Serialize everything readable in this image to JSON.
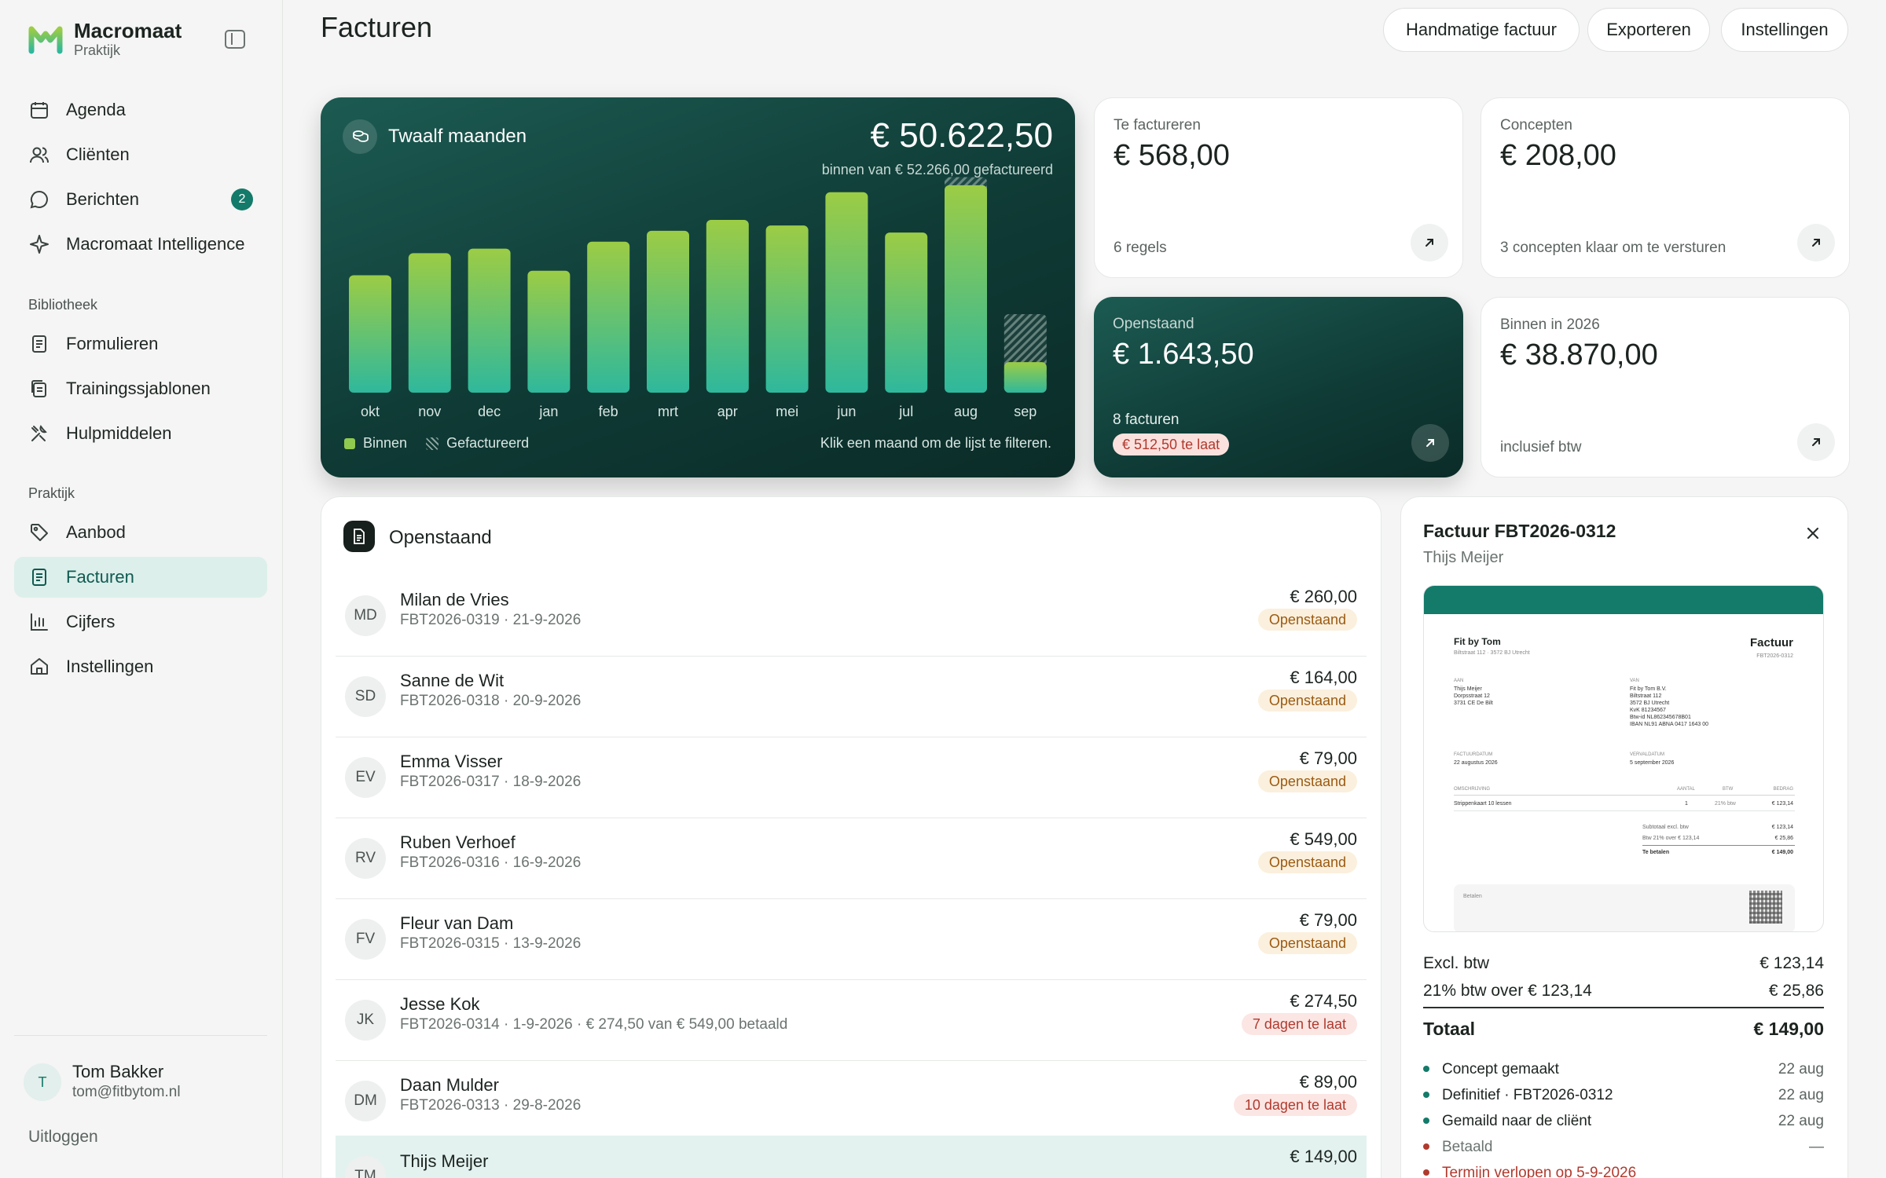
{
  "brand": {
    "name": "Macromaat",
    "sub": "Praktijk"
  },
  "nav": {
    "main": [
      {
        "label": "Agenda",
        "icon": "calendar-icon"
      },
      {
        "label": "Cliënten",
        "icon": "users-icon"
      },
      {
        "label": "Berichten",
        "icon": "message-icon",
        "badge": "2"
      },
      {
        "label": "Macromaat Intelligence",
        "icon": "sparkle-icon"
      }
    ],
    "library_heading": "Bibliotheek",
    "library": [
      {
        "label": "Formulieren",
        "icon": "form-icon"
      },
      {
        "label": "Trainingssjablonen",
        "icon": "template-icon"
      },
      {
        "label": "Hulpmiddelen",
        "icon": "tools-icon"
      }
    ],
    "practice_heading": "Praktijk",
    "practice": [
      {
        "label": "Aanbod",
        "icon": "tag-icon"
      },
      {
        "label": "Facturen",
        "icon": "invoice-icon",
        "active": true
      },
      {
        "label": "Cijfers",
        "icon": "bar-chart-icon"
      },
      {
        "label": "Instellingen",
        "icon": "home-settings-icon"
      }
    ]
  },
  "user": {
    "initial": "T",
    "name": "Tom Bakker",
    "email": "tom@fitbytom.nl",
    "logout": "Uitloggen"
  },
  "header": {
    "title": "Facturen",
    "buttons": {
      "manual": "Handmatige factuur",
      "export": "Exporteren",
      "settings": "Instellingen"
    }
  },
  "chart_card": {
    "title": "Twaalf maanden",
    "total": "€ 50.622,50",
    "subtitle": "binnen van € 52.266,00 gefactureerd",
    "legend_received": "Binnen",
    "legend_invoiced": "Gefactureerd",
    "hint": "Klik een maand om de lijst te filteren."
  },
  "chart_data": {
    "type": "bar",
    "categories": [
      "okt",
      "nov",
      "dec",
      "jan",
      "feb",
      "mrt",
      "apr",
      "mei",
      "jun",
      "jul",
      "aug",
      "sep"
    ],
    "series": [
      {
        "name": "Binnen",
        "values": [
          3350,
          3980,
          4110,
          3480,
          4310,
          4620,
          4930,
          4770,
          5720,
          4570,
          5920,
          870
        ]
      },
      {
        "name": "Gefactureerd",
        "values": [
          3350,
          3980,
          4110,
          3480,
          4310,
          4620,
          4930,
          4770,
          5720,
          4570,
          6150,
          2240
        ]
      }
    ],
    "ylim": [
      0,
      6500
    ],
    "colors": {
      "bar_top": "#9ccc45",
      "bar_bottom": "#2fb89c"
    }
  },
  "stats": {
    "to_invoice": {
      "label": "Te factureren",
      "value": "€ 568,00",
      "foot": "6 regels"
    },
    "concepts": {
      "label": "Concepten",
      "value": "€ 208,00",
      "foot": "3 concepten klaar om te versturen"
    },
    "open": {
      "label": "Openstaand",
      "value": "€ 1.643,50",
      "foot": "8 facturen",
      "late": "€ 512,50 te laat"
    },
    "received": {
      "label": "Binnen in 2026",
      "value": "€ 38.870,00",
      "foot": "inclusief btw"
    }
  },
  "list": {
    "title": "Openstaand",
    "rows": [
      {
        "initials": "MD",
        "name": "Milan de Vries",
        "meta": "FBT2026-0319 · 21-9-2026",
        "amount": "€ 260,00",
        "status": "Openstaand",
        "kind": "open"
      },
      {
        "initials": "SD",
        "name": "Sanne de Wit",
        "meta": "FBT2026-0318 · 20-9-2026",
        "amount": "€ 164,00",
        "status": "Openstaand",
        "kind": "open"
      },
      {
        "initials": "EV",
        "name": "Emma Visser",
        "meta": "FBT2026-0317 · 18-9-2026",
        "amount": "€ 79,00",
        "status": "Openstaand",
        "kind": "open"
      },
      {
        "initials": "RV",
        "name": "Ruben Verhoef",
        "meta": "FBT2026-0316 · 16-9-2026",
        "amount": "€ 549,00",
        "status": "Openstaand",
        "kind": "open"
      },
      {
        "initials": "FV",
        "name": "Fleur van Dam",
        "meta": "FBT2026-0315 · 13-9-2026",
        "amount": "€ 79,00",
        "status": "Openstaand",
        "kind": "open"
      },
      {
        "initials": "JK",
        "name": "Jesse Kok",
        "meta": "FBT2026-0314 · 1-9-2026 · € 274,50 van € 549,00 betaald",
        "amount": "€ 274,50",
        "status": "7 dagen te laat",
        "kind": "late"
      },
      {
        "initials": "DM",
        "name": "Daan Mulder",
        "meta": "FBT2026-0313 · 29-8-2026",
        "amount": "€ 89,00",
        "status": "10 dagen te laat",
        "kind": "late"
      },
      {
        "initials": "TM",
        "name": "Thijs Meijer",
        "meta": "",
        "amount": "€ 149,00",
        "status": "",
        "kind": "selected"
      }
    ]
  },
  "detail": {
    "title": "Factuur FBT2026-0312",
    "client": "Thijs Meijer",
    "preview": {
      "from_name": "Fit by Tom",
      "from_addr": "Biltstraat 112 · 3572 BJ Utrecht",
      "doc_title": "Factuur",
      "doc_no": "FBT2026-0312",
      "to_label": "AAN",
      "to_lines": [
        "Thijs Meijer",
        "Dorpsstraat 12",
        "3731 CE De Bilt"
      ],
      "van_label": "VAN",
      "van_lines": [
        "Fit by Tom B.V.",
        "Biltstraat 112",
        "3572 BJ Utrecht",
        "KvK 81234567",
        "Btw-id NL862345678B01",
        "IBAN NL91 ABNA 0417 1643 00"
      ],
      "date_label": "FACTUURDATUM",
      "date": "22 augustus 2026",
      "due_label": "VERVALDATUM",
      "due": "5 september 2026",
      "col_desc": "OMSCHRIJVING",
      "col_qty": "AANTAL",
      "col_vat": "BTW",
      "col_amount": "BEDRAG",
      "line_desc": "Strippenkaart 10 lessen",
      "line_qty": "1",
      "line_vat": "21% btw",
      "line_amount": "€ 123,14",
      "sub_label": "Subtotaal excl. btw",
      "sub_val": "€ 123,14",
      "vat_label": "Btw 21% over € 123,14",
      "vat_val": "€ 25,86",
      "total_label": "Te betalen",
      "total_val": "€ 149,00",
      "pay_label": "Betalen"
    },
    "excl_label": "Excl. btw",
    "excl_value": "€ 123,14",
    "vat_label": "21% btw over € 123,14",
    "vat_value": "€ 25,86",
    "total_label": "Totaal",
    "total_value": "€ 149,00",
    "timeline": [
      {
        "label": "Concept gemaakt",
        "date": "22 aug",
        "color": "#147a6a"
      },
      {
        "label": "Definitief · FBT2026-0312",
        "date": "22 aug",
        "color": "#147a6a"
      },
      {
        "label": "Gemaild naar de cliënt",
        "date": "22 aug",
        "color": "#147a6a"
      },
      {
        "label": "Betaald",
        "date": "—",
        "color": "#b03a2e"
      },
      {
        "label": "Termijn verlopen op 5-9-2026",
        "date": "",
        "color": "#b03a2e"
      }
    ]
  }
}
